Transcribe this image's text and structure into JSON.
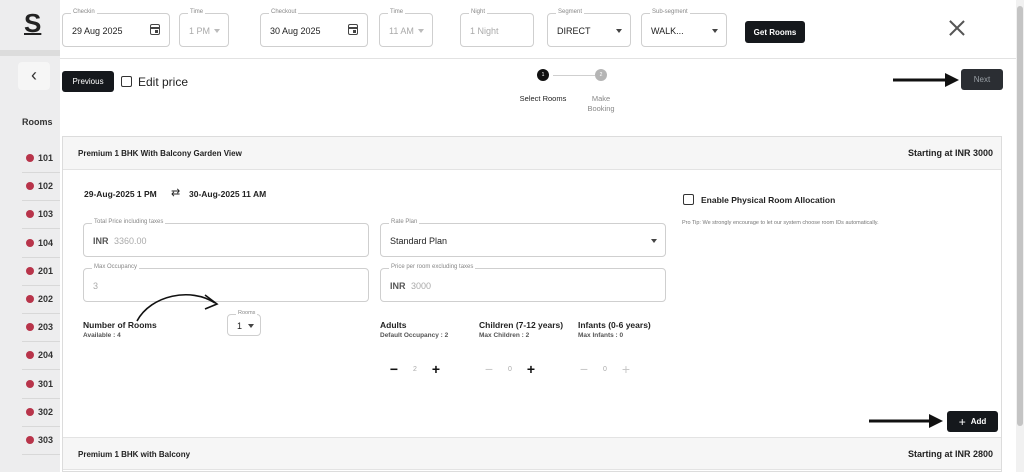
{
  "background": {
    "logo": "S",
    "back_icon": "chevron-left-icon",
    "rooms_label": "Rooms",
    "rooms": [
      "101",
      "102",
      "103",
      "104",
      "201",
      "202",
      "203",
      "204",
      "301",
      "302",
      "303"
    ],
    "room_dot_color": "#b8344a"
  },
  "filters": {
    "checkin": {
      "label": "Checkin",
      "value": "29 Aug 2025"
    },
    "checkin_time": {
      "label": "Time",
      "value": "1 PM"
    },
    "checkout": {
      "label": "Checkout",
      "value": "30 Aug 2025"
    },
    "checkout_time": {
      "label": "Time",
      "value": "11 AM"
    },
    "night": {
      "label": "Night",
      "value": "1 Night"
    },
    "segment": {
      "label": "Segment",
      "value": "DIRECT"
    },
    "subsegment": {
      "label": "Sub-segment",
      "value": "WALK..."
    },
    "get_rooms_label": "Get Rooms"
  },
  "toolbar": {
    "previous_label": "Previous",
    "edit_price_label": "Edit price",
    "next_label": "Next"
  },
  "steps": [
    {
      "number": "1",
      "label": "Select Rooms",
      "active": true
    },
    {
      "number": "2",
      "label": "Make Booking",
      "active": false
    }
  ],
  "room_card": {
    "title": "Premium 1 BHK With Balcony Garden View",
    "starting_price": "Starting at INR 3000",
    "checkin_dt": "29-Aug-2025 1 PM",
    "checkout_dt": "30-Aug-2025 11 AM",
    "swap_icon": "swap-arrows-icon",
    "total_price": {
      "label": "Total Price including taxes",
      "currency": "INR",
      "value": "3360.00"
    },
    "rate_plan": {
      "label": "Rate Plan",
      "value": "Standard Plan"
    },
    "max_occupancy": {
      "label": "Max Occupancy",
      "value": "3"
    },
    "price_per_room": {
      "label": "Price per room excluding taxes",
      "currency": "INR",
      "value": "3000"
    },
    "enable_allocation_label": "Enable Physical Room Allocation",
    "pro_tip": "Pro Tip: We strongly encourage to let our system choose room IDs automatically.",
    "number_of_rooms": {
      "title": "Number of Rooms",
      "sub": "Available : 4",
      "select_label": "Rooms",
      "select_value": "1"
    },
    "adults": {
      "title": "Adults",
      "sub": "Default Occupancy : 2",
      "value": "2"
    },
    "children": {
      "title": "Children (7-12 years)",
      "sub": "Max Children : 2",
      "value": "0"
    },
    "infants": {
      "title": "Infants (0-6 years)",
      "sub": "Max Infants : 0",
      "value": "0"
    },
    "add_label": "Add"
  },
  "next_room_card": {
    "title": "Premium 1 BHK with Balcony",
    "starting_price": "Starting at INR 2800"
  },
  "colors": {
    "primary_dark": "#15181c",
    "border": "#cfcfcf"
  }
}
